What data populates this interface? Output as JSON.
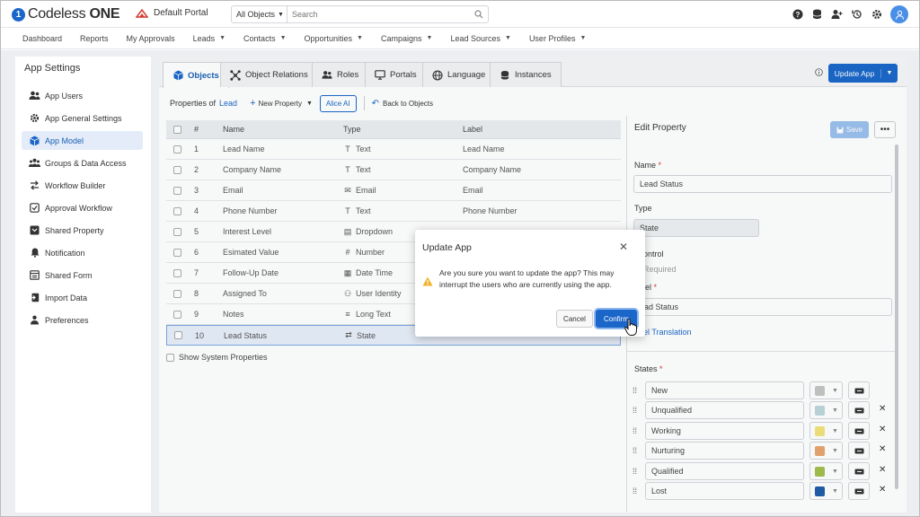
{
  "header": {
    "logo_name": "Codeless",
    "logo_suffix": "ONE",
    "portal": "Default Portal",
    "search_scope": "All Objects",
    "search_placeholder": "Search",
    "icons": [
      "help-icon",
      "database-icon",
      "add-user-icon",
      "history-icon",
      "gear-icon",
      "user-avatar-icon"
    ]
  },
  "nav": [
    {
      "label": "Dashboard",
      "dropdown": false
    },
    {
      "label": "Reports",
      "dropdown": false
    },
    {
      "label": "My Approvals",
      "dropdown": false
    },
    {
      "label": "Leads",
      "dropdown": true
    },
    {
      "label": "Contacts",
      "dropdown": true
    },
    {
      "label": "Opportunities",
      "dropdown": true
    },
    {
      "label": "Campaigns",
      "dropdown": true
    },
    {
      "label": "Lead Sources",
      "dropdown": true
    },
    {
      "label": "User Profiles",
      "dropdown": true
    }
  ],
  "sidebar": {
    "title": "App Settings",
    "items": [
      {
        "label": "App Users",
        "icon": "users-icon"
      },
      {
        "label": "App General Settings",
        "icon": "gear-icon"
      },
      {
        "label": "App Model",
        "icon": "cube-icon",
        "active": true
      },
      {
        "label": "Groups & Data Access",
        "icon": "groups-icon"
      },
      {
        "label": "Workflow Builder",
        "icon": "workflow-icon"
      },
      {
        "label": "Approval Workflow",
        "icon": "approval-icon"
      },
      {
        "label": "Shared Property",
        "icon": "shared-property-icon"
      },
      {
        "label": "Notification",
        "icon": "bell-icon"
      },
      {
        "label": "Shared Form",
        "icon": "form-icon"
      },
      {
        "label": "Import Data",
        "icon": "import-icon"
      },
      {
        "label": "Preferences",
        "icon": "preferences-icon"
      }
    ]
  },
  "tabs": [
    {
      "label": "Objects",
      "active": true
    },
    {
      "label": "Object Relations"
    },
    {
      "label": "Roles"
    },
    {
      "label": "Portals"
    },
    {
      "label": "Language"
    },
    {
      "label": "Instances"
    }
  ],
  "update_button": "Update App",
  "toolbar": {
    "properties_of": "Properties of",
    "object": "Lead",
    "new_property": "New Property",
    "alice": "Alice AI",
    "back": "Back to Objects"
  },
  "table": {
    "headers": [
      "#",
      "Name",
      "Type",
      "Label"
    ],
    "rows": [
      {
        "num": "1",
        "name": "Lead Name",
        "type": "Text",
        "type_icon": "T",
        "label": "Lead Name"
      },
      {
        "num": "2",
        "name": "Company Name",
        "type": "Text",
        "type_icon": "T",
        "label": "Company Name"
      },
      {
        "num": "3",
        "name": "Email",
        "type": "Email",
        "type_icon": "✉",
        "label": "Email"
      },
      {
        "num": "4",
        "name": "Phone Number",
        "type": "Text",
        "type_icon": "T",
        "label": "Phone Number"
      },
      {
        "num": "5",
        "name": "Interest Level",
        "type": "Dropdown",
        "type_icon": "▤",
        "label": ""
      },
      {
        "num": "6",
        "name": "Esimated Value",
        "type": "Number",
        "type_icon": "#",
        "label": ""
      },
      {
        "num": "7",
        "name": "Follow-Up Date",
        "type": "Date Time",
        "type_icon": "▦",
        "label": ""
      },
      {
        "num": "8",
        "name": "Assigned To",
        "type": "User Identity",
        "type_icon": "⚇",
        "label": ""
      },
      {
        "num": "9",
        "name": "Notes",
        "type": "Long Text",
        "type_icon": "≡",
        "label": ""
      },
      {
        "num": "10",
        "name": "Lead Status",
        "type": "State",
        "type_icon": "⇄",
        "label": "",
        "selected": true
      }
    ],
    "show_system": "Show System Properties"
  },
  "edit_property": {
    "title": "Edit Property",
    "save": "Save",
    "more": "•••",
    "name_label": "Name",
    "name_value": "Lead Status",
    "type_label": "Type",
    "type_value": "State",
    "control_label": "ontrol",
    "required_label": "Required",
    "label_label": "el",
    "label_value": "ead Status",
    "translation_link": "el Translation",
    "states_label": "States",
    "states": [
      {
        "name": "New",
        "color": "#c4c4c4",
        "removable": false
      },
      {
        "name": "Unqualified",
        "color": "#bcd6dc",
        "removable": true
      },
      {
        "name": "Working",
        "color": "#f2e27a",
        "removable": true
      },
      {
        "name": "Nurturing",
        "color": "#e9a56e",
        "removable": true
      },
      {
        "name": "Qualified",
        "color": "#a3bf4c",
        "removable": true
      },
      {
        "name": "Lost",
        "color": "#1f5ba8",
        "removable": true
      }
    ]
  },
  "modal": {
    "title": "Update App",
    "close": "✕",
    "message": "Are you sure you want to update the app? This may interrupt the users who are currently using the app.",
    "cancel": "Cancel",
    "confirm": "Confirm"
  }
}
